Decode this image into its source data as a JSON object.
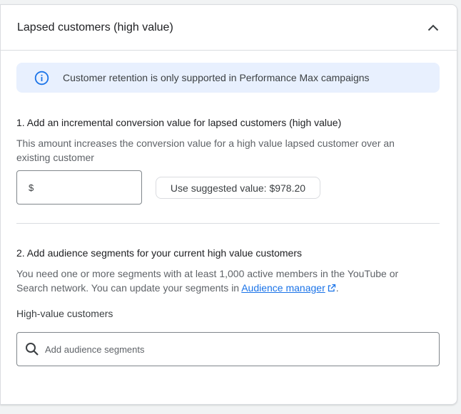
{
  "card": {
    "title": "Lapsed customers (high value)"
  },
  "info_banner": {
    "icon": "info-icon",
    "text": "Customer retention is only supported in Performance Max campaigns"
  },
  "section1": {
    "heading": "1. Add an incremental conversion value for lapsed customers (high value)",
    "help": "This amount increases the conversion value for a high value lapsed customer over an existing customer",
    "currency_symbol": "$",
    "input_value": "",
    "suggest_button": "Use suggested value: $978.20"
  },
  "section2": {
    "heading": "2. Add audience segments for your current high value customers",
    "help_before_link": "You need one or more segments with at least 1,000 active members in the YouTube or Search network. You can update your segments in ",
    "link_text": "Audience manager",
    "help_after_link": ".",
    "field_label": "High-value customers",
    "search_placeholder": "Add audience segments"
  },
  "colors": {
    "accent": "#1a73e8",
    "banner_bg": "#e8f0fe"
  }
}
